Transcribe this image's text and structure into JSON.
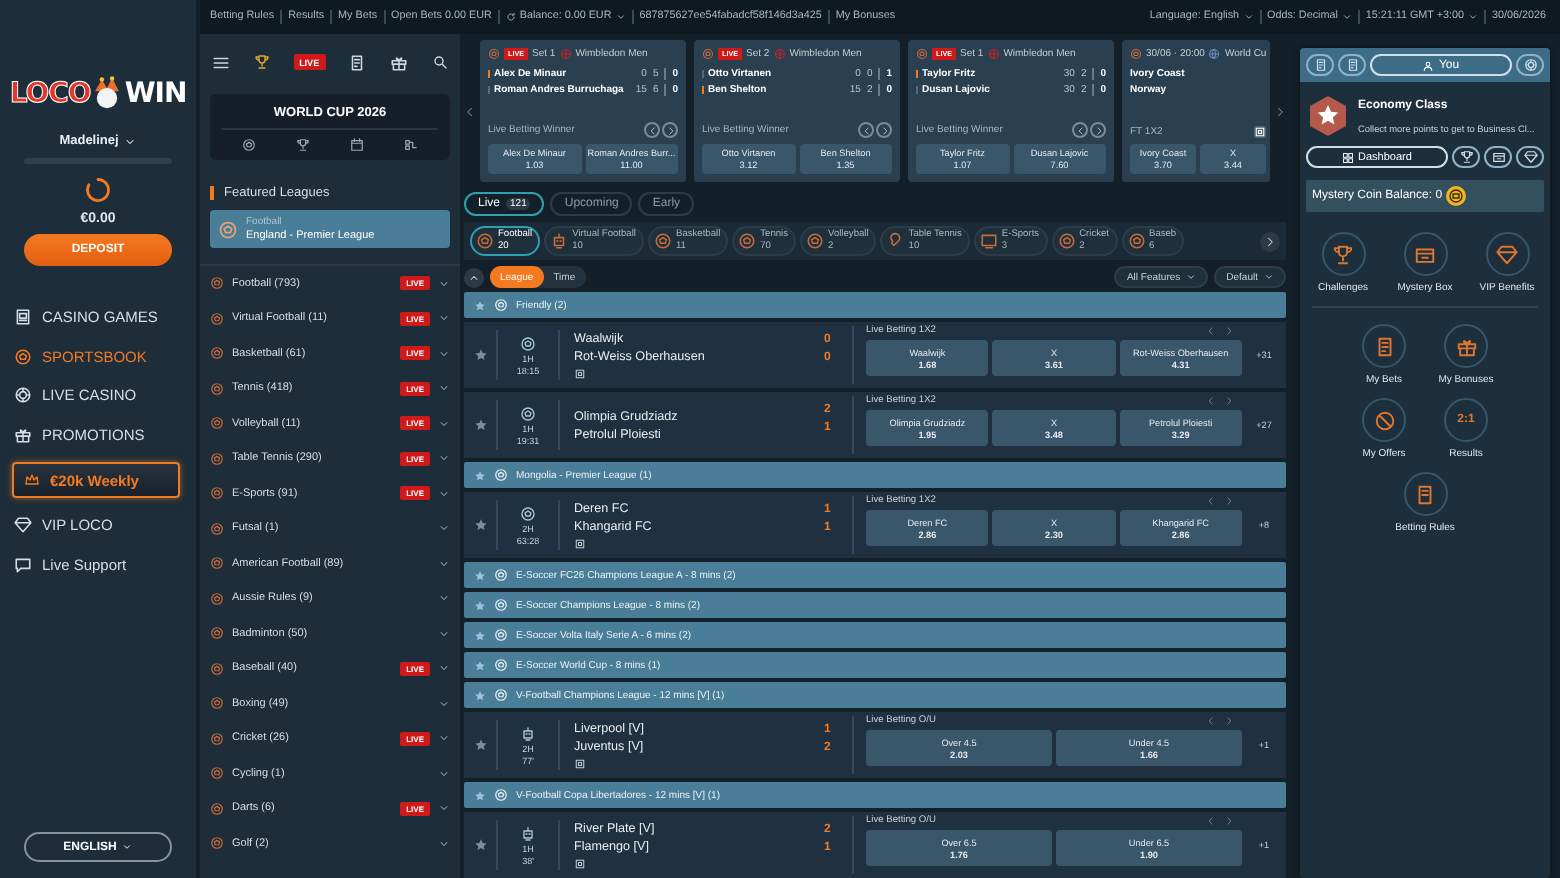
{
  "top_bar": {
    "links": [
      {
        "text": "Betting Rules"
      },
      {
        "text": "Results"
      },
      {
        "text": "My Bets"
      },
      {
        "text": "Open Bets 0.00 EUR"
      },
      {
        "text": "Balance: 0.00 EUR",
        "refresh": true,
        "dropdown": true
      },
      {
        "text": "687875627ee54fabadcf58f146d3a425"
      },
      {
        "text": "My Bonuses"
      }
    ],
    "settings": [
      {
        "text": "Language: English",
        "dropdown": true
      },
      {
        "text": "Odds: Decimal",
        "dropdown": true
      },
      {
        "text": "15:21:11 GMT +3:00",
        "dropdown": true
      },
      {
        "text": "30/06/2026"
      }
    ]
  },
  "nav": {
    "logo": [
      "LOCO",
      "WIN"
    ],
    "user": "Madelinej",
    "balance": "€0.00",
    "deposit": "DEPOSIT",
    "items": [
      {
        "label": "CASINO GAMES",
        "kind": "link",
        "selected": false
      },
      {
        "label": "SPORTSBOOK",
        "kind": "link",
        "selected": true
      },
      {
        "label": "LIVE CASINO",
        "kind": "link",
        "selected": false
      },
      {
        "label": "PROMOTIONS",
        "kind": "link",
        "selected": false
      },
      {
        "label": "€20k Weekly",
        "kind": "promo",
        "selected": false
      },
      {
        "label": "VIP LOCO",
        "kind": "link",
        "selected": false
      },
      {
        "label": "Live Support",
        "kind": "link",
        "selected": false
      }
    ],
    "language": "ENGLISH"
  },
  "sports_menu": {
    "live_badge": "LIVE",
    "world_cup": "WORLD CUP 2026",
    "featured_title": "Featured Leagues",
    "featured": {
      "sport": "Football",
      "league": "England - Premier League"
    },
    "sports": [
      {
        "label": "Football (793)",
        "badge": "LIVE"
      },
      {
        "label": "Virtual Football (11)",
        "badge": "LIVE"
      },
      {
        "label": "Basketball (61)",
        "badge": "LIVE"
      },
      {
        "label": "Tennis (418)",
        "badge": "LIVE"
      },
      {
        "label": "Volleyball (11)",
        "badge": "LIVE"
      },
      {
        "label": "Table Tennis (290)",
        "badge": "LIVE"
      },
      {
        "label": "E-Sports (91)",
        "badge": "LIVE"
      },
      {
        "label": "Futsal (1)"
      },
      {
        "label": "American Football (89)"
      },
      {
        "label": "Aussie Rules (9)"
      },
      {
        "label": "Badminton (50)"
      },
      {
        "label": "Baseball (40)",
        "badge": "LIVE"
      },
      {
        "label": "Boxing (49)"
      },
      {
        "label": "Cricket (26)",
        "badge": "LIVE"
      },
      {
        "label": "Cycling (1)"
      },
      {
        "label": "Darts (6)",
        "badge": "LIVE"
      },
      {
        "label": "Golf (2)"
      }
    ]
  },
  "top_matches": [
    {
      "kind": "live",
      "badge": "LIVE",
      "status": "Set 1",
      "competition": "Wimbledon Men",
      "players": [
        {
          "name": "Alex De Minaur",
          "serving": true,
          "scores": [
            "0",
            "5",
            "0"
          ]
        },
        {
          "name": "Roman Andres Burruchaga",
          "serving": false,
          "scores": [
            "15",
            "6",
            "0"
          ]
        }
      ],
      "market": "Live Betting Winner",
      "odds": [
        {
          "label": "Alex De Minaur",
          "value": "1.03"
        },
        {
          "label": "Roman Andres Burr...",
          "value": "11.00"
        }
      ]
    },
    {
      "kind": "live",
      "badge": "LIVE",
      "status": "Set 2",
      "competition": "Wimbledon Men",
      "players": [
        {
          "name": "Otto Virtanen",
          "serving": false,
          "scores": [
            "0",
            "0",
            "1"
          ]
        },
        {
          "name": "Ben Shelton",
          "serving": true,
          "scores": [
            "15",
            "2",
            "0"
          ]
        }
      ],
      "market": "Live Betting Winner",
      "odds": [
        {
          "label": "Otto Virtanen",
          "value": "3.12"
        },
        {
          "label": "Ben Shelton",
          "value": "1.35"
        }
      ]
    },
    {
      "kind": "live",
      "badge": "LIVE",
      "status": "Set 1",
      "competition": "Wimbledon Men",
      "players": [
        {
          "name": "Taylor Fritz",
          "serving": true,
          "scores": [
            "30",
            "2",
            "0"
          ]
        },
        {
          "name": "Dusan Lajovic",
          "serving": false,
          "scores": [
            "30",
            "2",
            "0"
          ]
        }
      ],
      "market": "Live Betting Winner",
      "odds": [
        {
          "label": "Taylor Fritz",
          "value": "1.07"
        },
        {
          "label": "Dusan Lajovic",
          "value": "7.60"
        }
      ]
    },
    {
      "kind": "scheduled",
      "status": "30/06 · 20:00",
      "competition": "World Cu",
      "players": [
        {
          "name": "Ivory Coast"
        },
        {
          "name": "Norway"
        }
      ],
      "market": "FT 1X2",
      "odds": [
        {
          "label": "Ivory Coast",
          "value": "3.70"
        },
        {
          "label": "X",
          "value": "3.44"
        }
      ]
    }
  ],
  "tabs": [
    {
      "label": "Live",
      "count": "121",
      "selected": true
    },
    {
      "label": "Upcoming",
      "selected": false
    },
    {
      "label": "Early",
      "selected": false
    }
  ],
  "sport_chips": [
    {
      "label": "Football",
      "count": "20",
      "selected": true
    },
    {
      "label": "Virtual Football",
      "count": "10",
      "selected": false
    },
    {
      "label": "Basketball",
      "count": "11",
      "selected": false
    },
    {
      "label": "Tennis",
      "count": "70",
      "selected": false
    },
    {
      "label": "Volleyball",
      "count": "2",
      "selected": false
    },
    {
      "label": "Table Tennis",
      "count": "10",
      "selected": false
    },
    {
      "label": "E-Sports",
      "count": "3",
      "selected": false
    },
    {
      "label": "Cricket",
      "count": "2",
      "selected": false
    },
    {
      "label": "Baseb",
      "count": "6",
      "selected": false
    }
  ],
  "sort": {
    "options": [
      {
        "label": "League",
        "selected": true
      },
      {
        "label": "Time",
        "selected": false
      }
    ],
    "filters": [
      "All Features",
      "Default"
    ]
  },
  "events": [
    {
      "kind": "league",
      "name": "Friendly (2)"
    },
    {
      "kind": "match",
      "virtual": false,
      "period": "1H",
      "clock": "18:15",
      "home": "Waalwijk",
      "away": "Rot-Weiss Oberhausen",
      "home_score": "0",
      "away_score": "0",
      "stats": true,
      "market": "Live Betting 1X2",
      "odds": [
        {
          "label": "Waalwijk",
          "value": "1.68"
        },
        {
          "label": "X",
          "value": "3.61"
        },
        {
          "label": "Rot-Weiss Oberhausen",
          "value": "4.31"
        }
      ],
      "more": "+31"
    },
    {
      "kind": "match",
      "virtual": false,
      "period": "1H",
      "clock": "19:31",
      "home": "Olimpia Grudziadz",
      "away": "Petrolul Ploiesti",
      "home_score": "2",
      "away_score": "1",
      "stats": false,
      "market": "Live Betting 1X2",
      "odds": [
        {
          "label": "Olimpia Grudziadz",
          "value": "1.95"
        },
        {
          "label": "X",
          "value": "3.48"
        },
        {
          "label": "Petrolul Ploiesti",
          "value": "3.29"
        }
      ],
      "more": "+27"
    },
    {
      "kind": "league",
      "name": "Mongolia - Premier League (1)"
    },
    {
      "kind": "match",
      "virtual": false,
      "period": "2H",
      "clock": "63:28",
      "home": "Deren FC",
      "away": "Khangarid FC",
      "home_score": "1",
      "away_score": "1",
      "stats": true,
      "market": "Live Betting 1X2",
      "odds": [
        {
          "label": "Deren FC",
          "value": "2.86"
        },
        {
          "label": "X",
          "value": "2.30"
        },
        {
          "label": "Khangarid FC",
          "value": "2.86"
        }
      ],
      "more": "+8"
    },
    {
      "kind": "league",
      "name": "E-Soccer FC26 Champions League A - 8 mins (2)"
    },
    {
      "kind": "league",
      "name": "E-Soccer Champions League - 8 mins (2)"
    },
    {
      "kind": "league",
      "name": "E-Soccer Volta Italy Serie A - 6 mins (2)"
    },
    {
      "kind": "league",
      "name": "E-Soccer World Cup - 8 mins (1)"
    },
    {
      "kind": "league",
      "name": "V-Football Champions League - 12 mins [V] (1)"
    },
    {
      "kind": "match",
      "virtual": true,
      "period": "2H",
      "clock": "77'",
      "home": "Liverpool [V]",
      "away": "Juventus [V]",
      "home_score": "1",
      "away_score": "2",
      "stats": true,
      "market": "Live Betting O/U",
      "odds": [
        {
          "label": "Over 4.5",
          "value": "2.03"
        },
        {
          "label": "Under 4.5",
          "value": "1.66"
        }
      ],
      "more": "+1"
    },
    {
      "kind": "league",
      "name": "V-Football Copa Libertadores - 12 mins [V] (1)"
    },
    {
      "kind": "match",
      "virtual": true,
      "period": "1H",
      "clock": "38'",
      "home": "River Plate [V]",
      "away": "Flamengo [V]",
      "home_score": "2",
      "away_score": "1",
      "stats": true,
      "market": "Live Betting O/U",
      "odds": [
        {
          "label": "Over 6.5",
          "value": "1.76"
        },
        {
          "label": "Under 6.5",
          "value": "1.90"
        }
      ],
      "more": "+1"
    }
  ],
  "rewards": {
    "user_button": "You",
    "rank": "Economy Class",
    "rank_note": "Collect more points to get to Business Cl...",
    "dashboard": "Dashboard",
    "coin_balance": "Mystery Coin Balance: 0",
    "sections": [
      {
        "items": [
          {
            "label": "Challenges"
          },
          {
            "label": "Mystery Box"
          },
          {
            "label": "VIP Benefits"
          }
        ]
      },
      {
        "items": [
          {
            "label": "My Bets"
          },
          {
            "label": "My Bonuses"
          },
          {
            "label": "My Offers"
          },
          {
            "label": "Results",
            "icon_text": "2:1"
          },
          {
            "label": "Betting Rules"
          }
        ]
      }
    ]
  }
}
